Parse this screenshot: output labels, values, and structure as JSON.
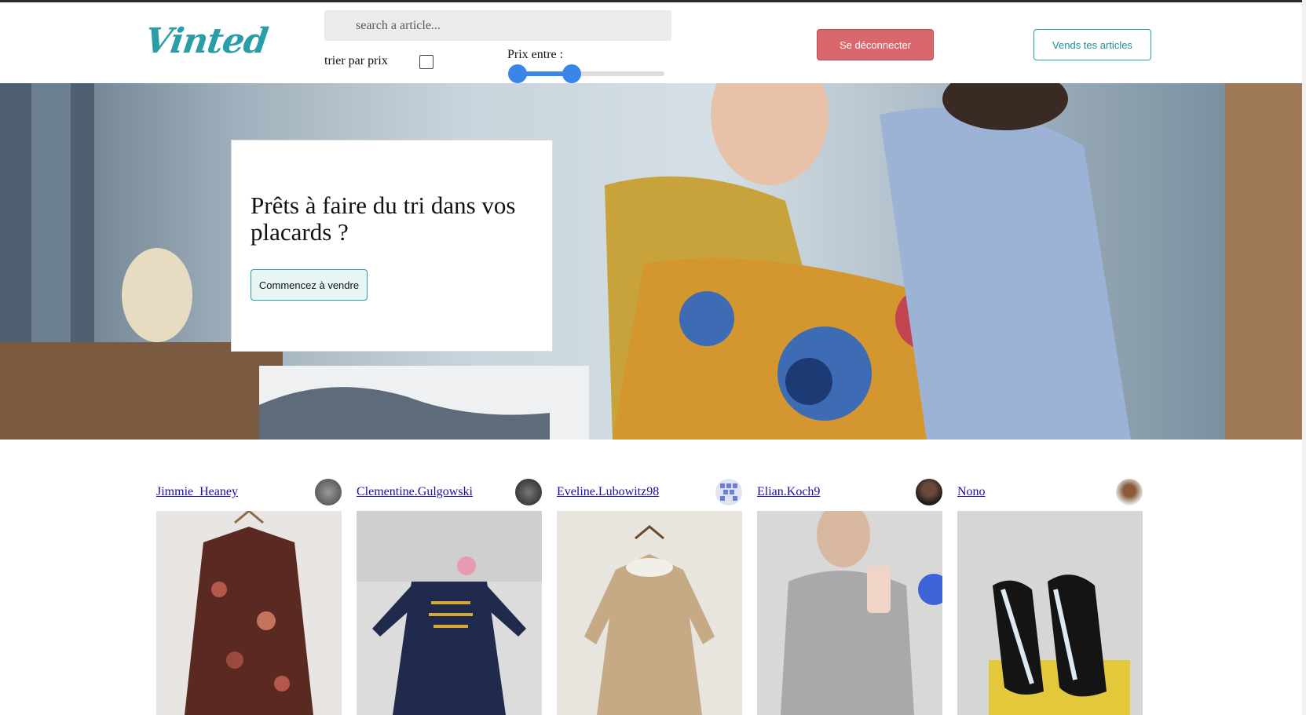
{
  "app": {
    "brand": "Vinted",
    "brand_color": "#2a9ea6"
  },
  "header": {
    "search_placeholder": "search a article...",
    "sort_label": "trier par prix",
    "sort_checked": false,
    "price_label": "Prix entre :",
    "price_range_fraction": [
      0.0,
      0.37
    ],
    "logout_label": "Se déconnecter",
    "sell_label": "Vends tes articles",
    "logout_color": "#d9676e"
  },
  "hero": {
    "title": "Prêts à faire du tri dans vos placards ?",
    "cta_label": "Commencez à vendre"
  },
  "offers": [
    {
      "username": "Jimmie_Heaney"
    },
    {
      "username": "Clementine.Gulgowski"
    },
    {
      "username": "Eveline.Lubowitz98"
    },
    {
      "username": "Elian.Koch9"
    },
    {
      "username": "Nono"
    }
  ]
}
